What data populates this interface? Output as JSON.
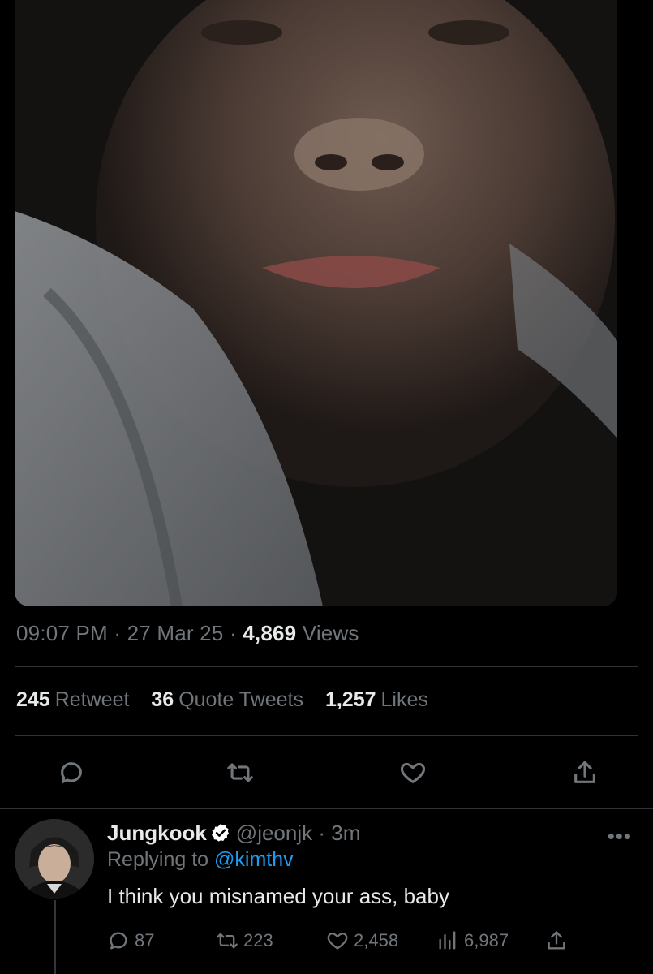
{
  "tweet": {
    "time": "09:07 PM",
    "sep": "·",
    "date": "27 Mar 25",
    "views_count": "4,869",
    "views_label": "Views",
    "retweets_count": "245",
    "retweets_label": "Retweet",
    "quotes_count": "36",
    "quotes_label": "Quote Tweets",
    "likes_count": "1,257",
    "likes_label": "Likes",
    "actions": [
      "reply-icon",
      "retweet-icon",
      "like-icon",
      "share-icon"
    ]
  },
  "reply": {
    "name": "Jungkook",
    "handle": "@jeonjk",
    "sep": "·",
    "time": "3m",
    "more": "•••",
    "replying_prefix": "Replying to",
    "replying_to": "@kimthv",
    "text": "I think you misnamed your ass, baby",
    "replies": "87",
    "retweets": "223",
    "likes": "2,458",
    "views": "6,987"
  },
  "colors": {
    "background": "#000000",
    "accent": "#1d9bf0",
    "muted": "#71767b",
    "text": "#e7e9ea"
  }
}
